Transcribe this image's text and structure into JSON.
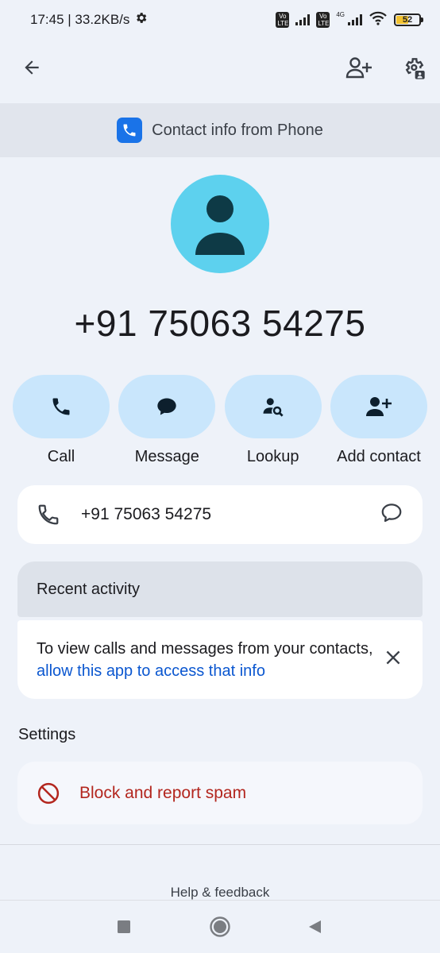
{
  "status_bar": {
    "time_speed": "17:45 | 33.2KB/s",
    "volte_1": "Vo LTE",
    "volte_2": "Vo LTE",
    "network": "4G",
    "battery": "52"
  },
  "banner": {
    "text": "Contact info from Phone"
  },
  "contact": {
    "number": "+91 75063 54275"
  },
  "actions": [
    {
      "label": "Call",
      "icon": "phone-icon"
    },
    {
      "label": "Message",
      "icon": "message-icon"
    },
    {
      "label": "Lookup",
      "icon": "lookup-icon"
    },
    {
      "label": "Add contact",
      "icon": "add-contact-icon"
    }
  ],
  "phone_row": {
    "number": "+91 75063 54275"
  },
  "recent_activity": {
    "title": "Recent activity",
    "message_prefix": "To view calls and messages from your contacts, ",
    "message_link": "allow this app to access that info"
  },
  "settings": {
    "title": "Settings",
    "block_label": "Block and report spam"
  },
  "footer": {
    "help": "Help & feedback"
  },
  "colors": {
    "accent_blue": "#0b57d0",
    "avatar": "#5dd1ee",
    "action_pill": "#c9e6fc",
    "danger": "#b3261e"
  }
}
